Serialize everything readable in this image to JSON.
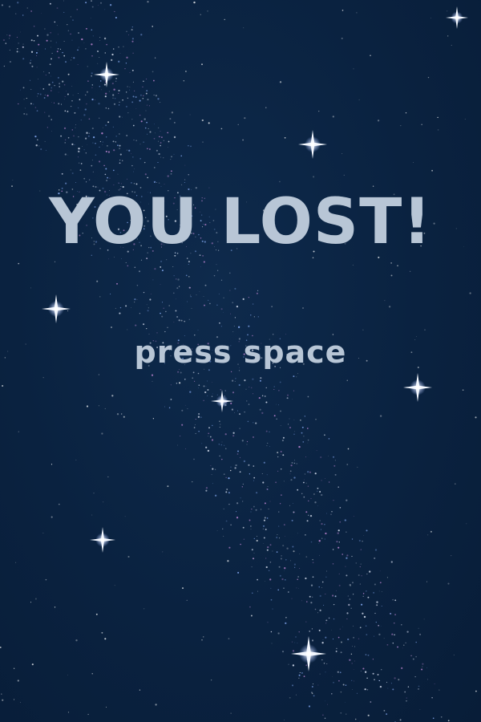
{
  "screen": {
    "title": "YOU LOST!",
    "prompt": "press space"
  },
  "colors": {
    "background": "#0b2340",
    "text": "#b8c6d6",
    "star": "#ffffff",
    "dust_pink": "#c68ad8",
    "dust_blue": "#8fb4ff"
  }
}
